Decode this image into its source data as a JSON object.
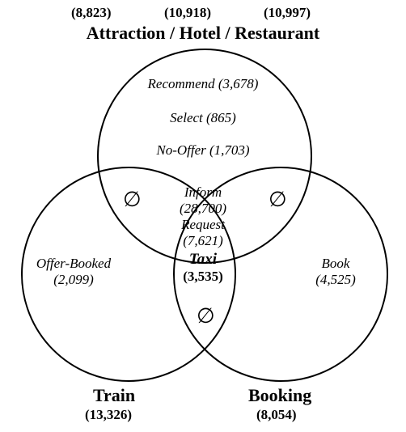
{
  "header": {
    "attraction_count": "(8,823)",
    "hotel_count": "(10,918)",
    "restaurant_count": "(10,997)",
    "title": "Attraction / Hotel / Restaurant"
  },
  "footer": {
    "train_label": "Train",
    "train_count": "(13,326)",
    "booking_label": "Booking",
    "booking_count": "(8,054)"
  },
  "regions": {
    "top_only": {
      "recommend": "Recommend (3,678)",
      "select": "Select (865)",
      "nooffer": "No-Offer (1,703)"
    },
    "left_only": "Offer-Booked\n(2,099)",
    "right_only": "Book\n(4,525)",
    "top_left": "∅",
    "top_right": "∅",
    "left_right": "∅",
    "center": {
      "inform": "Inform\n(28,700)",
      "request": "Request\n(7,621)",
      "taxi_label": "Taxi",
      "taxi_count": "(3,535)"
    }
  },
  "chart_data": {
    "type": "venn3",
    "sets": [
      {
        "name": "Attraction / Hotel / Restaurant",
        "subcounts": {
          "Attraction": 8823,
          "Hotel": 10918,
          "Restaurant": 10997
        }
      },
      {
        "name": "Train",
        "count": 13326
      },
      {
        "name": "Booking",
        "count": 8054
      }
    ],
    "regions": {
      "A_only": [
        {
          "label": "Recommend",
          "value": 3678
        },
        {
          "label": "Select",
          "value": 865
        },
        {
          "label": "No-Offer",
          "value": 1703
        }
      ],
      "B_only": [
        {
          "label": "Offer-Booked",
          "value": 2099
        }
      ],
      "C_only": [
        {
          "label": "Book",
          "value": 4525
        }
      ],
      "A_and_B": [],
      "A_and_C": [],
      "B_and_C": [],
      "A_and_B_and_C": [
        {
          "label": "Inform",
          "value": 28700
        },
        {
          "label": "Request",
          "value": 7621
        },
        {
          "label": "Taxi",
          "value": 3535
        }
      ]
    }
  }
}
